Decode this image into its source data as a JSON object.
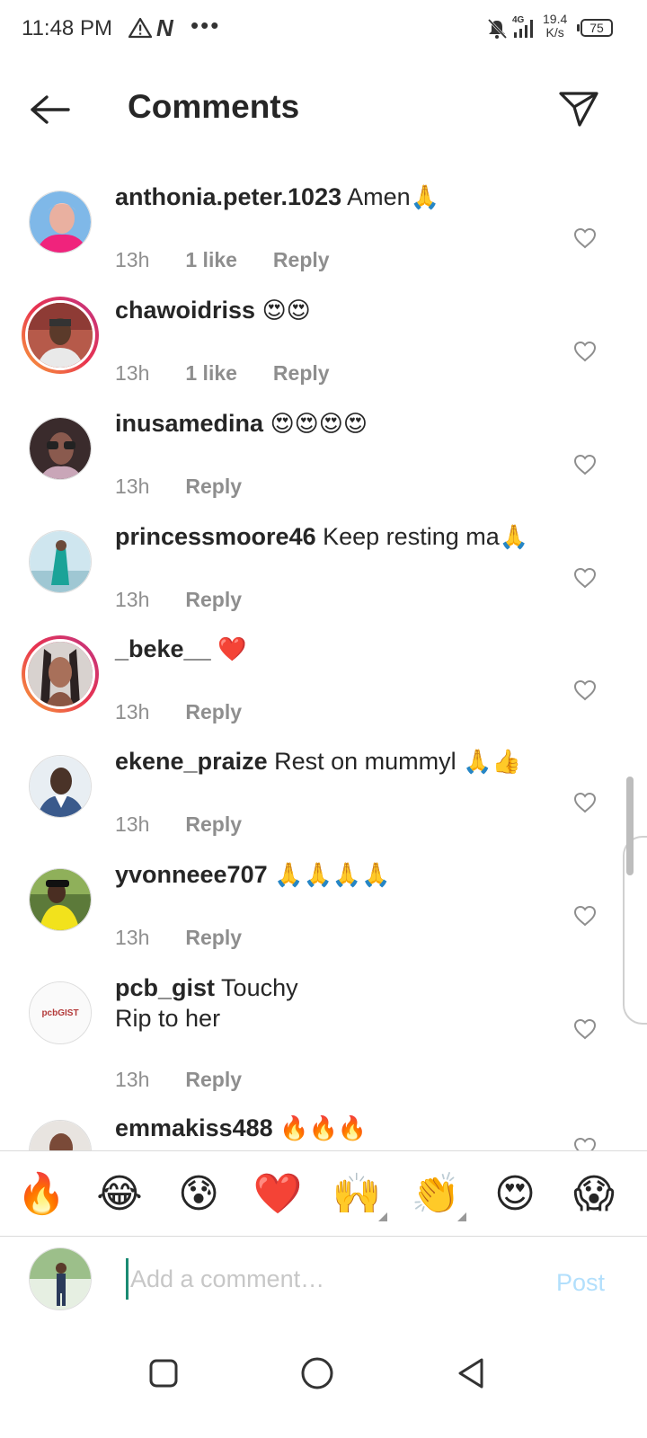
{
  "status_bar": {
    "time": "11:48 PM",
    "network": "4G",
    "speed_value": "19.4",
    "speed_unit": "K/s",
    "battery": "75",
    "icons": [
      "warning-icon",
      "n-app-icon",
      "more-dots-icon",
      "mute-bell-icon",
      "signal-icon",
      "battery-icon"
    ]
  },
  "header": {
    "title": "Comments",
    "back_icon": "arrow-left-icon",
    "share_icon": "paper-plane-icon"
  },
  "comments": [
    {
      "username": "anthonia.peter.1023",
      "text": "Amen",
      "emoji": "🙏",
      "time": "13h",
      "likes": "1 like",
      "reply": "Reply"
    },
    {
      "username": "chawoidriss",
      "text": "",
      "emoji": "😍😍",
      "time": "13h",
      "likes": "1 like",
      "reply": "Reply"
    },
    {
      "username": "inusamedina",
      "text": "",
      "emoji": "😍😍😍😍",
      "time": "13h",
      "likes": "",
      "reply": "Reply"
    },
    {
      "username": "princessmoore46",
      "text": "Keep resting ma",
      "emoji": "🙏",
      "time": "13h",
      "likes": "",
      "reply": "Reply"
    },
    {
      "username": "_beke__",
      "text": "",
      "emoji": "❤️",
      "time": "13h",
      "likes": "",
      "reply": "Reply"
    },
    {
      "username": "ekene_praize",
      "text": "Rest on mummyl",
      "emoji": "🙏👍",
      "time": "13h",
      "likes": "",
      "reply": "Reply"
    },
    {
      "username": "yvonneee707",
      "text": "",
      "emoji": "🙏🙏🙏🙏",
      "time": "13h",
      "likes": "",
      "reply": "Reply"
    },
    {
      "username": "pcb_gist",
      "text": "Touchy",
      "text_line2": "Rip to her",
      "emoji": "",
      "time": "13h",
      "likes": "",
      "reply": "Reply",
      "avatar_logo_text": "pcbGIST"
    },
    {
      "username": "emmakiss488",
      "text": "",
      "emoji": "🔥🔥🔥",
      "time": "",
      "likes": "",
      "reply": ""
    }
  ],
  "emoji_bar": [
    "🔥",
    "😂",
    "😰",
    "❤️",
    "🙌",
    "👏",
    "😍",
    "😱"
  ],
  "input": {
    "placeholder": "Add a comment…",
    "post_label": "Post"
  },
  "nav": {
    "icons": [
      "recents-square-icon",
      "home-circle-icon",
      "back-triangle-icon"
    ]
  },
  "colors": {
    "text": "#262626",
    "meta": "#8e8e8e",
    "post_disabled": "#b2dffc",
    "story_ring_start": "#f9a43a",
    "story_ring_end": "#c13584"
  }
}
